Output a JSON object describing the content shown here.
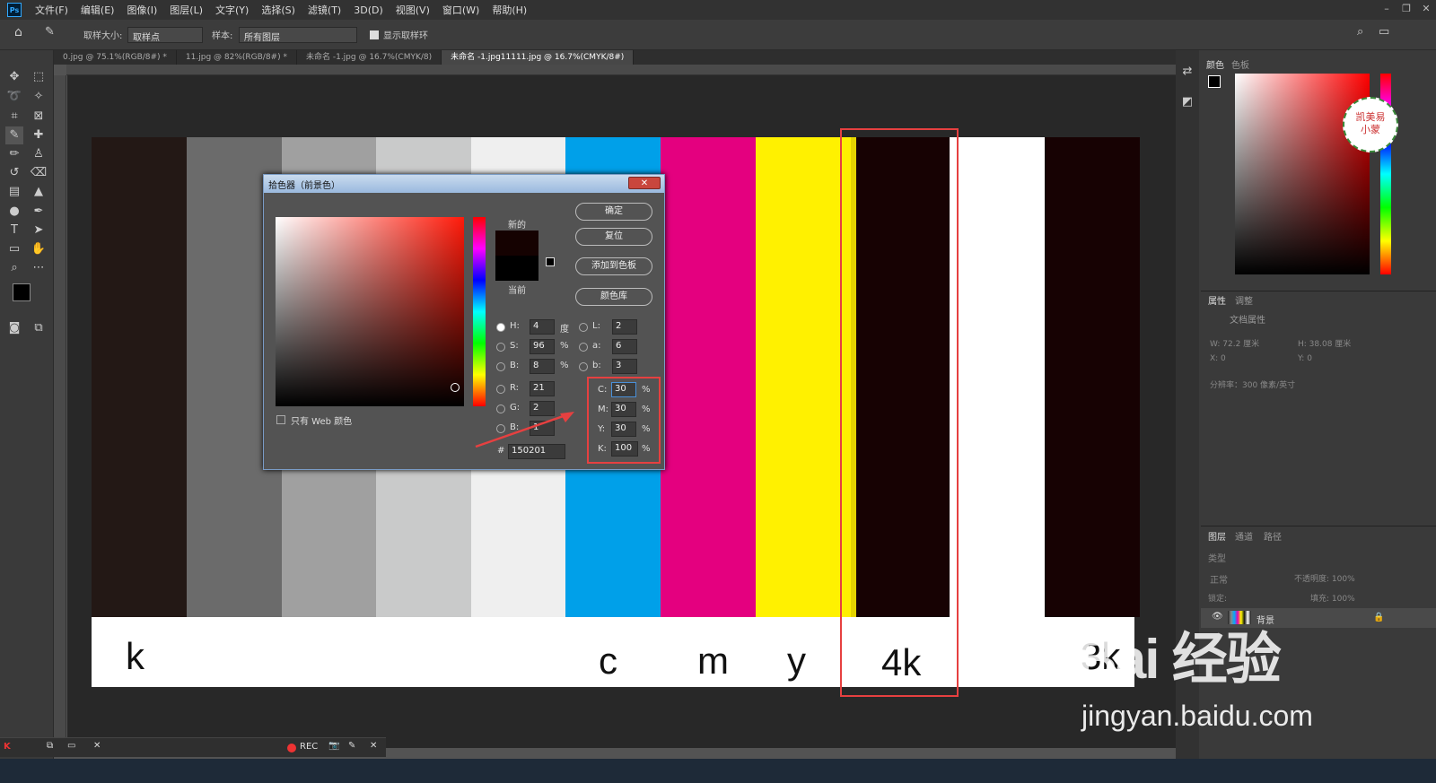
{
  "menu": [
    "文件(F)",
    "编辑(E)",
    "图像(I)",
    "图层(L)",
    "文字(Y)",
    "选择(S)",
    "滤镜(T)",
    "3D(D)",
    "视图(V)",
    "窗口(W)",
    "帮助(H)"
  ],
  "options": {
    "size_label": "取样大小:",
    "size_value": "取样点",
    "sample_label": "样本:",
    "sample_value": "所有图层",
    "ring_label": "显示取样环"
  },
  "tabs": [
    "0.jpg @ 75.1%(RGB/8#) *",
    "11.jpg @ 82%(RGB/8#) *",
    "未命名 -1.jpg @ 16.7%(CMYK/8)",
    "未命名 -1.jpg11111.jpg @ 16.7%(CMYK/8#)"
  ],
  "bars": [
    "#231815",
    "#6b6b6b",
    "#a0a0a0",
    "#c9caca",
    "#efefef",
    "#00a0e9",
    "#e4007f",
    "#fff100",
    "#e5d400",
    "#170203",
    "#ffffff",
    "#ffffff",
    "#170203"
  ],
  "labels": {
    "k": "k",
    "c": "c",
    "m": "m",
    "y": "y",
    "k4": "4k",
    "k3": "3k"
  },
  "dialog": {
    "title": "拾色器（前景色）",
    "new_label": "新的",
    "current_label": "当前",
    "ok": "确定",
    "reset": "复位",
    "add_swatch": "添加到色板",
    "library": "颜色库",
    "web_only": "只有 Web 颜色",
    "H": "4",
    "S": "96",
    "B": "8",
    "R": "21",
    "G": "2",
    "Bv": "1",
    "L": "2",
    "a": "6",
    "b": "3",
    "C": "30",
    "M": "30",
    "Y": "30",
    "K": "100",
    "hex": "150201",
    "deg": "度",
    "pct": "%",
    "new_color": "#150201",
    "current_color": "#000000"
  },
  "right_panel": {
    "color_tab": "颜色",
    "swatch_tab": "色板",
    "props_tab": "属性",
    "adjust_tab": "调整",
    "doc_props": "文档属性",
    "w": "W: 72.2 厘米",
    "h": "H: 38.08 厘米",
    "x": "X: 0",
    "y": "Y: 0",
    "res": "分辨率：300 像素/英寸",
    "layers_tab": "图层",
    "channels_tab": "通道",
    "paths_tab": "路径",
    "kind": "类型",
    "blend": "正常",
    "opacity": "不透明度: 100%",
    "lock": "锁定:",
    "fill": "填充: 100%",
    "layer_name": "背景",
    "logo1": "凯美易",
    "logo2": "小蒙"
  },
  "rec": {
    "label": "REC"
  },
  "watermark": {
    "top": "Bai  经验",
    "bottom": "jingyan.baidu.com"
  }
}
